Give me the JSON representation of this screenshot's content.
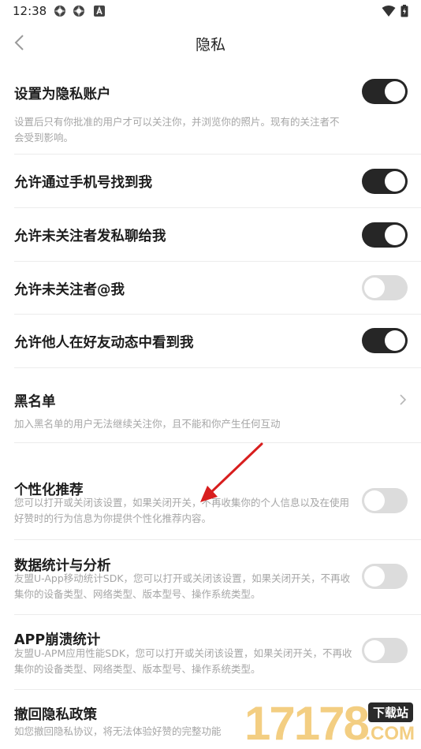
{
  "status_bar": {
    "time": "12:38",
    "icons": [
      "app-icon",
      "app-icon",
      "a-icon"
    ],
    "right_icons": [
      "wifi-icon",
      "battery-icon"
    ]
  },
  "header": {
    "title": "隐私",
    "back_icon": "chevron-left-icon"
  },
  "settings": [
    {
      "label": "设置为隐私账户",
      "desc": "设置后只有你批准的用户才可以关注你，并浏览你的照片。现有的关注者不会受到影响。",
      "control": "toggle",
      "enabled": true
    },
    {
      "label": "允许通过手机号找到我",
      "control": "toggle",
      "enabled": true
    },
    {
      "label": "允许未关注者发私聊给我",
      "control": "toggle",
      "enabled": true
    },
    {
      "label": "允许未关注者@我",
      "control": "toggle",
      "enabled": false
    },
    {
      "label": "允许他人在好友动态中看到我",
      "control": "toggle",
      "enabled": true
    },
    {
      "label": "黑名单",
      "desc": "加入黑名单的用户无法继续关注你，且不能和你产生任何互动",
      "control": "chevron"
    },
    {
      "label": "个性化推荐",
      "desc": "您可以打开或关闭该设置，如果关闭开关，不再收集你的个人信息以及在使用好赞时的行为信息为你提供个性化推荐内容。",
      "control": "toggle",
      "enabled": false
    },
    {
      "label": "数据统计与分析",
      "desc": "友盟U-App移动统计SDK，您可以打开或关闭该设置，如果关闭开关，不再收集你的设备类型、网络类型、版本型号、操作系统类型。",
      "control": "toggle",
      "enabled": false
    },
    {
      "label": "APP崩溃统计",
      "desc": "友盟U-APM应用性能SDK，您可以打开或关闭该设置，如果关闭开关，不再收集你的设备类型、网络类型、版本型号、操作系统类型。",
      "control": "toggle",
      "enabled": false
    },
    {
      "label": "撤回隐私政策",
      "desc": "如您撤回隐私协议，将无法体验好赞的完整功能",
      "control": "chevron"
    }
  ],
  "colors": {
    "toggle_on": "#262626",
    "toggle_off": "#dcdcdc",
    "annotation_arrow": "#d81e1e",
    "watermark": "#f2c66d"
  },
  "watermark": {
    "number": "17178",
    "badge": "下载站",
    "suffix": ".COM"
  }
}
